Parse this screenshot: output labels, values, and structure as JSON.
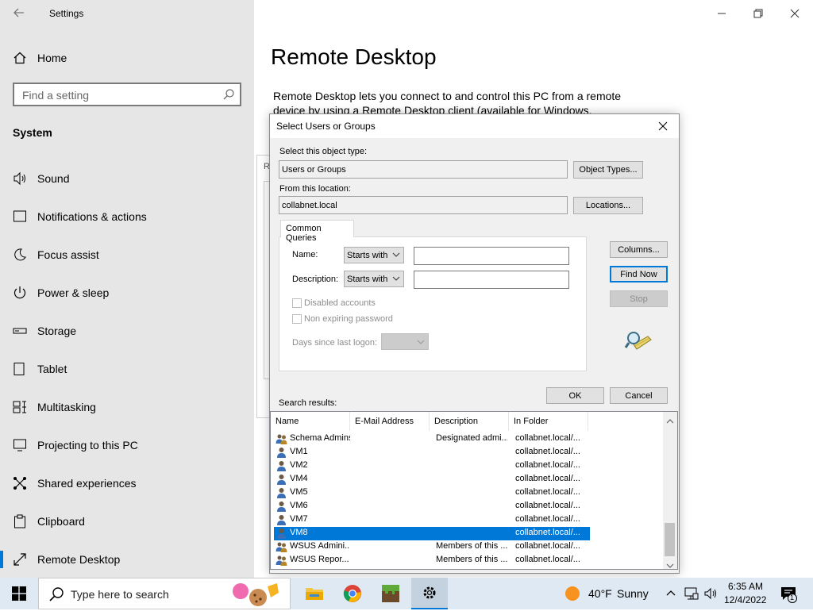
{
  "settings": {
    "title": "Settings",
    "home": "Home",
    "search_placeholder": "Find a setting",
    "section": "System",
    "nav": [
      {
        "label": "Sound",
        "icon": "speaker-icon"
      },
      {
        "label": "Notifications & actions",
        "icon": "notification-icon"
      },
      {
        "label": "Focus assist",
        "icon": "moon-icon"
      },
      {
        "label": "Power & sleep",
        "icon": "power-icon"
      },
      {
        "label": "Storage",
        "icon": "storage-icon"
      },
      {
        "label": "Tablet",
        "icon": "tablet-icon"
      },
      {
        "label": "Multitasking",
        "icon": "multitasking-icon"
      },
      {
        "label": "Projecting to this PC",
        "icon": "projecting-icon"
      },
      {
        "label": "Shared experiences",
        "icon": "shared-icon"
      },
      {
        "label": "Clipboard",
        "icon": "clipboard-icon"
      },
      {
        "label": "Remote Desktop",
        "icon": "remote-desktop-icon"
      }
    ],
    "page_title": "Remote Desktop",
    "description_line1": "Remote Desktop lets you connect to and control this PC from a remote",
    "description_line2": "device by using a Remote Desktop client (available for Windows,",
    "obscured_letter": "R"
  },
  "dialog": {
    "title": "Select Users or Groups",
    "object_type_label": "Select this object type:",
    "object_type_value": "Users or Groups",
    "object_types_button": "Object Types...",
    "location_label": "From this location:",
    "location_value": "collabnet.local",
    "locations_button": "Locations...",
    "tab": "Common Queries",
    "name_label": "Name:",
    "name_mode": "Starts with",
    "description_label": "Description:",
    "description_mode": "Starts with",
    "disabled_accounts": "Disabled accounts",
    "non_expiring": "Non expiring password",
    "days_label": "Days since last logon:",
    "columns_button": "Columns...",
    "find_now_button": "Find Now",
    "stop_button": "Stop",
    "ok_button": "OK",
    "cancel_button": "Cancel",
    "search_results_label": "Search results:",
    "columns": [
      "Name",
      "E-Mail Address",
      "Description",
      "In Folder"
    ],
    "rows": [
      {
        "name": "Schema Admins",
        "email": "",
        "description": "Designated admi...",
        "folder": "collabnet.local/...",
        "type": "group"
      },
      {
        "name": "VM1",
        "email": "",
        "description": "",
        "folder": "collabnet.local/...",
        "type": "user"
      },
      {
        "name": "VM2",
        "email": "",
        "description": "",
        "folder": "collabnet.local/...",
        "type": "user"
      },
      {
        "name": "VM4",
        "email": "",
        "description": "",
        "folder": "collabnet.local/...",
        "type": "user"
      },
      {
        "name": "VM5",
        "email": "",
        "description": "",
        "folder": "collabnet.local/...",
        "type": "user"
      },
      {
        "name": "VM6",
        "email": "",
        "description": "",
        "folder": "collabnet.local/...",
        "type": "user"
      },
      {
        "name": "VM7",
        "email": "",
        "description": "",
        "folder": "collabnet.local/...",
        "type": "user"
      },
      {
        "name": "VM8",
        "email": "",
        "description": "",
        "folder": "collabnet.local/...",
        "type": "user",
        "selected": true
      },
      {
        "name": "WSUS Admini...",
        "email": "",
        "description": "Members of this ...",
        "folder": "collabnet.local/...",
        "type": "group"
      },
      {
        "name": "WSUS Repor...",
        "email": "",
        "description": "Members of this ...",
        "folder": "collabnet.local/...",
        "type": "group"
      }
    ]
  },
  "taskbar": {
    "search_placeholder": "Type here to search",
    "weather_temp": "40°F",
    "weather_text": "Sunny",
    "time": "6:35 AM",
    "date": "12/4/2022",
    "notification_count": "1"
  },
  "colors": {
    "accent": "#0078d7",
    "sidebar_bg": "#e6e6e6",
    "taskbar_bg": "#dfe9f3"
  }
}
